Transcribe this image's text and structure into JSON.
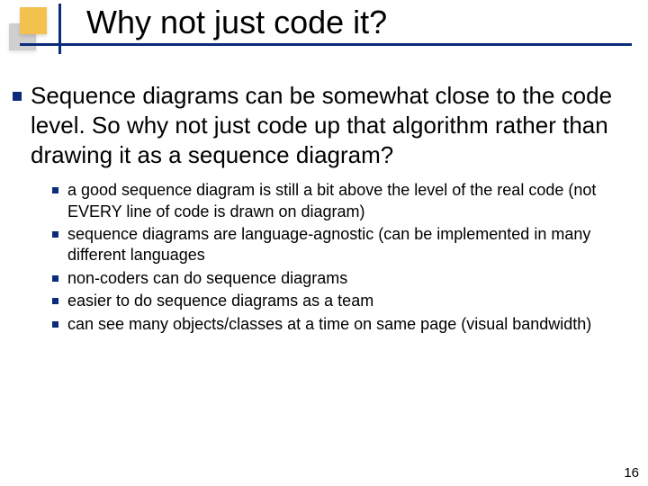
{
  "title": "Why not just code it?",
  "main_text": "Sequence diagrams can be somewhat close to the code level.  So why not just code up that algorithm rather than drawing it as a sequence diagram?",
  "sub": {
    "b1": "a good sequence diagram is still a bit above the level of the real code (not EVERY line of code is drawn on diagram)",
    "b2": "sequence diagrams are language-agnostic (can be implemented in many different languages",
    "b3": "non-coders can do sequence diagrams",
    "b4": "easier to do sequence diagrams as a team",
    "b5": "can see many objects/classes at a time on same page (visual bandwidth)"
  },
  "page_number": "16"
}
